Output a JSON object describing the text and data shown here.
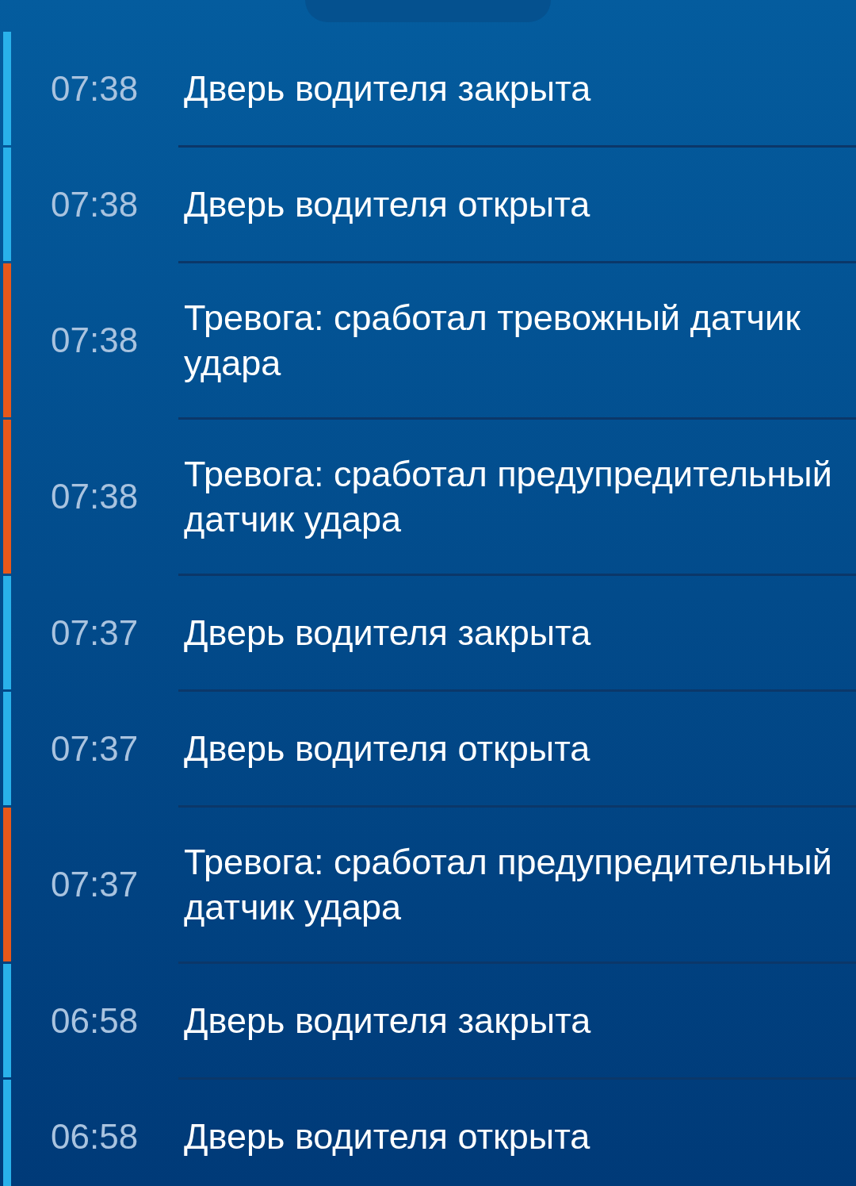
{
  "events": [
    {
      "time": "07:38",
      "text": "Дверь водителя закрыта",
      "color": "#29b1ea"
    },
    {
      "time": "07:38",
      "text": "Дверь водителя открыта",
      "color": "#29b1ea"
    },
    {
      "time": "07:38",
      "text": "Тревога: сработал тревожный датчик удара",
      "color": "#e8581a"
    },
    {
      "time": "07:38",
      "text": "Тревога: сработал предупредительный датчик удара",
      "color": "#e8581a"
    },
    {
      "time": "07:37",
      "text": "Дверь водителя закрыта",
      "color": "#29b1ea"
    },
    {
      "time": "07:37",
      "text": "Дверь водителя открыта",
      "color": "#29b1ea"
    },
    {
      "time": "07:37",
      "text": "Тревога: сработал предупредительный датчик удара",
      "color": "#e8581a"
    },
    {
      "time": "06:58",
      "text": "Дверь водителя закрыта",
      "color": "#29b1ea"
    },
    {
      "time": "06:58",
      "text": "Дверь водителя открыта",
      "color": "#29b1ea"
    }
  ]
}
